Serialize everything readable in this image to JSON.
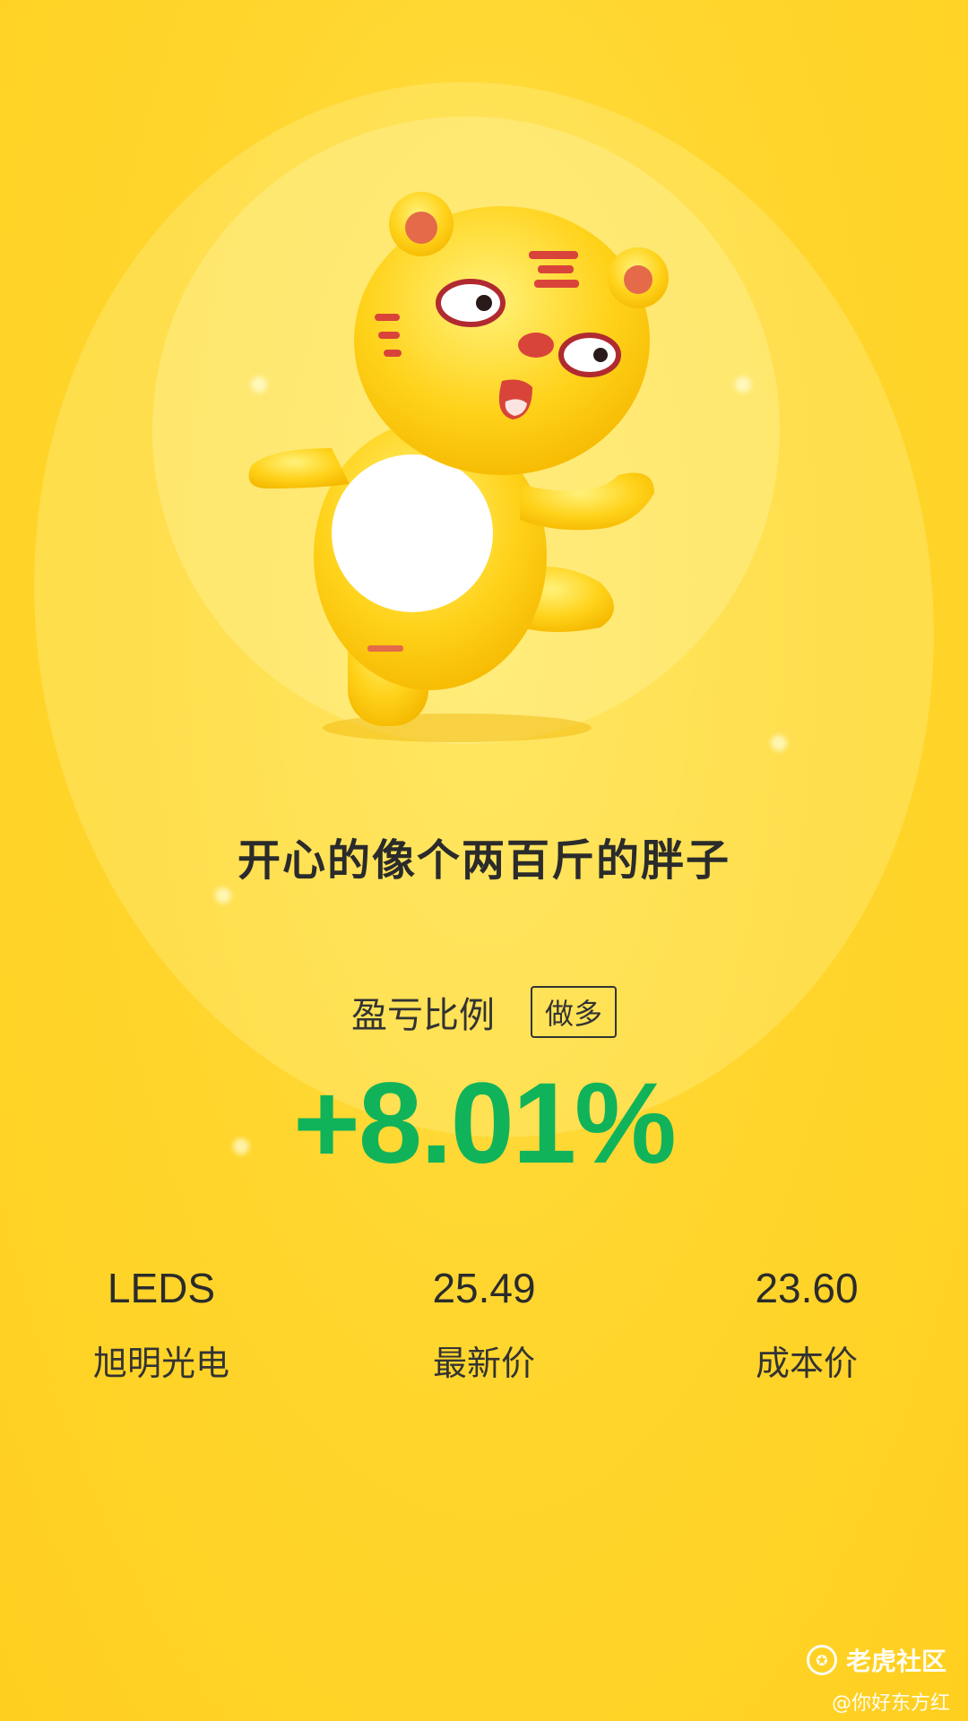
{
  "share_card": {
    "headline": "开心的像个两百斤的胖子",
    "ratio_label": "盈亏比例",
    "position_tag": "做多",
    "pnl_percent": "+8.01%",
    "colors": {
      "background": "#ffd62e",
      "gain": "#11b35a",
      "text": "#2b2b2b"
    },
    "mascot_icon": "tiger-mascot-icon"
  },
  "stock": {
    "ticker": "LEDS",
    "name": "旭明光电",
    "latest_price": "25.49",
    "latest_price_label": "最新价",
    "cost_price": "23.60",
    "cost_price_label": "成本价"
  },
  "footer": {
    "brand_name": "老虎社区",
    "brand_icon": "tiger-logo-icon",
    "user_handle": "@你好东方红"
  }
}
